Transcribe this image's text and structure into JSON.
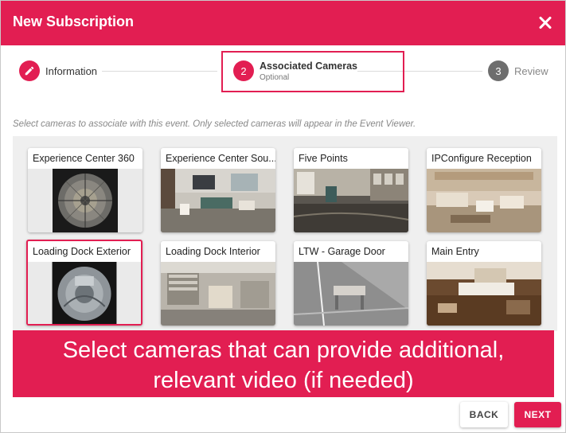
{
  "dialog": {
    "title": "New Subscription",
    "accent_color": "#e21e52"
  },
  "stepper": {
    "steps": [
      {
        "number": "",
        "label": "Information",
        "sublabel": "",
        "icon": "pencil-icon",
        "state": "completed"
      },
      {
        "number": "2",
        "label": "Associated Cameras",
        "sublabel": "Optional",
        "state": "active"
      },
      {
        "number": "3",
        "label": "Review",
        "sublabel": "",
        "state": "inactive"
      }
    ]
  },
  "hint": "Select cameras to associate with this event. Only selected cameras will appear in the Event Viewer.",
  "cameras": [
    {
      "name": "Experience Center 360",
      "selected": false
    },
    {
      "name": "Experience Center Sou...",
      "selected": false
    },
    {
      "name": "Five Points",
      "selected": false
    },
    {
      "name": "IPConfigure Reception",
      "selected": false
    },
    {
      "name": "Loading Dock Exterior",
      "selected": true
    },
    {
      "name": "Loading Dock Interior",
      "selected": false
    },
    {
      "name": "LTW - Garage Door",
      "selected": false
    },
    {
      "name": "Main Entry",
      "selected": false
    }
  ],
  "banner": {
    "line1": "Select cameras that can provide additional,",
    "line2": "relevant video (if needed)"
  },
  "actions": {
    "back_label": "BACK",
    "next_label": "NEXT"
  }
}
